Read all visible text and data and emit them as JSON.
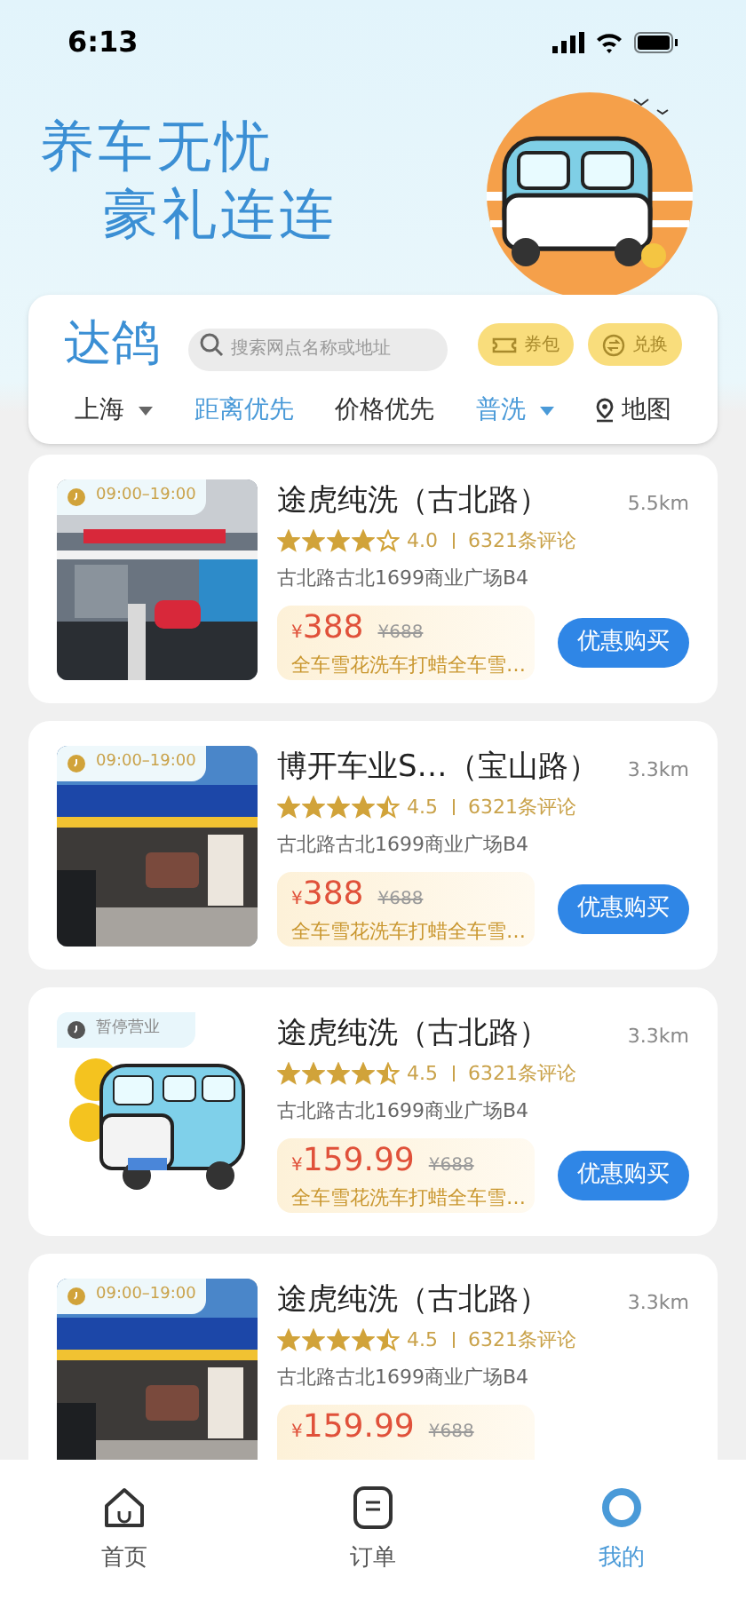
{
  "status_bar": {
    "time": "6:13"
  },
  "banner": {
    "lines": [
      "养车无忧",
      "豪礼连连"
    ]
  },
  "header": {
    "brand": "达鸽",
    "search": {
      "placeholder": "搜索网点名称或地址"
    },
    "buttons": [
      {
        "label": "券包",
        "kind": "coupon"
      },
      {
        "label": "兑换",
        "kind": "exchange"
      }
    ],
    "filters": [
      {
        "label": "上海",
        "kind": "dropdown",
        "selected": false
      },
      {
        "label": "距离优先",
        "kind": "sort",
        "selected": true
      },
      {
        "label": "价格优先",
        "kind": "sort",
        "selected": false
      },
      {
        "label": "普洗",
        "kind": "dropdown",
        "selected": true
      },
      {
        "label": "地图",
        "kind": "map",
        "selected": false
      }
    ]
  },
  "stores": [
    {
      "badge": {
        "kind": "open",
        "text": "09:00–19:00"
      },
      "name": "途虎纯洗（古北路）",
      "distance": "5.5km",
      "stars": 4,
      "rating": "4.0",
      "reviews": "6321条评论",
      "address": "古北路古北1699商业广场B4",
      "price": "388",
      "currency": "¥",
      "original_price": "¥688",
      "description": "全车雪花洗车打蜡全车雪…",
      "button": "优惠购买"
    },
    {
      "badge": {
        "kind": "open",
        "text": "09:00–19:00"
      },
      "name": "博开车业S…（宝山路）",
      "distance": "3.3km",
      "stars": 4.5,
      "rating": "4.5",
      "reviews": "6321条评论",
      "address": "古北路古北1699商业广场B4",
      "price": "388",
      "currency": "¥",
      "original_price": "¥688",
      "description": "全车雪花洗车打蜡全车雪…",
      "button": "优惠购买"
    },
    {
      "badge": {
        "kind": "closed",
        "text": "暂停营业"
      },
      "name": "途虎纯洗（古北路）",
      "distance": "3.3km",
      "stars": 4.5,
      "rating": "4.5",
      "reviews": "6321条评论",
      "address": "古北路古北1699商业广场B4",
      "price": "159.99",
      "currency": "¥",
      "original_price": "¥688",
      "description": "全车雪花洗车打蜡全车雪…",
      "button": "优惠购买"
    },
    {
      "badge": {
        "kind": "open",
        "text": "09:00–19:00"
      },
      "name": "途虎纯洗（古北路）",
      "distance": "3.3km",
      "stars": 4.5,
      "rating": "4.5",
      "reviews": "6321条评论",
      "address": "古北路古北1699商业广场B4",
      "price": "159.99",
      "currency": "¥",
      "original_price": "¥688"
    }
  ],
  "tab_bar": [
    {
      "label": "首页",
      "kind": "home",
      "selected": false
    },
    {
      "label": "订单",
      "kind": "orders",
      "selected": false
    },
    {
      "label": "我的",
      "kind": "profile",
      "selected": true
    }
  ]
}
